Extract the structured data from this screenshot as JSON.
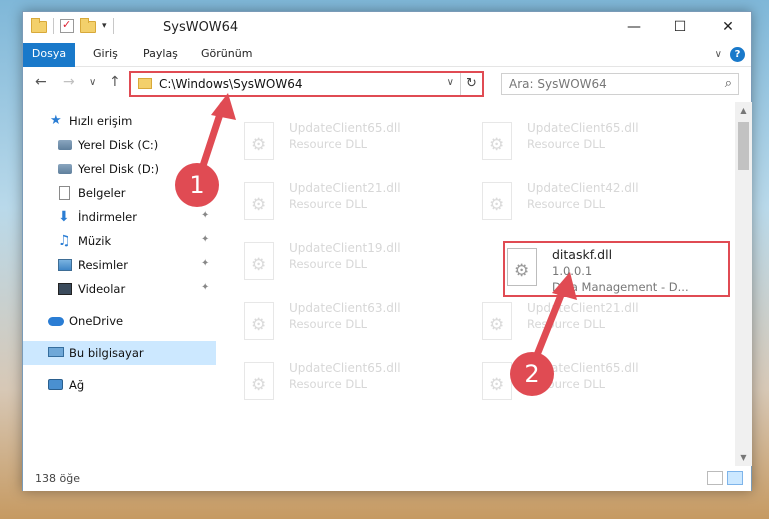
{
  "window": {
    "title": "SysWOW64",
    "minimize_glyph": "—",
    "maximize_glyph": "☐",
    "close_glyph": "✕"
  },
  "ribbon": {
    "tabs": [
      "Dosya",
      "Giriş",
      "Paylaş",
      "Görünüm"
    ],
    "help_glyph": "?",
    "collapse_glyph": "∨"
  },
  "navigation": {
    "back_glyph": "←",
    "forward_glyph": "→",
    "recent_glyph": "∨",
    "up_glyph": "↑",
    "address": "C:\\Windows\\SysWOW64",
    "address_dropdown_glyph": "∨",
    "refresh_glyph": "↻",
    "search_placeholder": "Ara: SysWOW64",
    "search_glyph": "⌕"
  },
  "sidebar": {
    "items": [
      {
        "label": "Hızlı erişim",
        "icon": "star-icon",
        "pinned": false
      },
      {
        "label": "Yerel Disk (C:)",
        "icon": "drive-icon",
        "pinned": false
      },
      {
        "label": "Yerel Disk (D:)",
        "icon": "drive-icon",
        "pinned": true
      },
      {
        "label": "Belgeler",
        "icon": "documents-icon",
        "pinned": true
      },
      {
        "label": "İndirmeler",
        "icon": "downloads-icon",
        "pinned": true
      },
      {
        "label": "Müzik",
        "icon": "music-icon",
        "pinned": true
      },
      {
        "label": "Resimler",
        "icon": "pictures-icon",
        "pinned": true
      },
      {
        "label": "Videolar",
        "icon": "videos-icon",
        "pinned": true
      },
      {
        "label": "OneDrive",
        "icon": "onedrive-icon",
        "pinned": false
      },
      {
        "label": "Bu bilgisayar",
        "icon": "this-pc-icon",
        "pinned": false,
        "selected": true
      },
      {
        "label": "Ağ",
        "icon": "network-icon",
        "pinned": false
      }
    ],
    "pin_glyph": "📌"
  },
  "files": {
    "left_column": [
      {
        "name": "UpdateClient65.dll",
        "desc": "Resource DLL"
      },
      {
        "name": "UpdateClient21.dll",
        "desc": "Resource DLL"
      },
      {
        "name": "UpdateClient19.dll",
        "desc": "Resource DLL"
      },
      {
        "name": "UpdateClient63.dll",
        "desc": "Resource DLL"
      },
      {
        "name": "UpdateClient65.dll",
        "desc": "Resource DLL"
      }
    ],
    "right_column": [
      {
        "name": "UpdateClient65.dll",
        "desc": "Resource DLL"
      },
      {
        "name": "UpdateClient42.dll",
        "desc": "Resource DLL"
      },
      {
        "name": "UpdateClient21.dll",
        "desc": "Resource DLL"
      },
      {
        "name": "UpdateClient65.dll",
        "desc": "Resource DLL"
      }
    ],
    "target": {
      "name": "ditaskf.dll",
      "version": "1.0.0.1",
      "desc": "Diva Management - D..."
    },
    "gear_glyph": "⚙"
  },
  "status": {
    "item_count": "138 öğe"
  },
  "callouts": {
    "first": "1",
    "second": "2",
    "color": "#e04b53"
  }
}
